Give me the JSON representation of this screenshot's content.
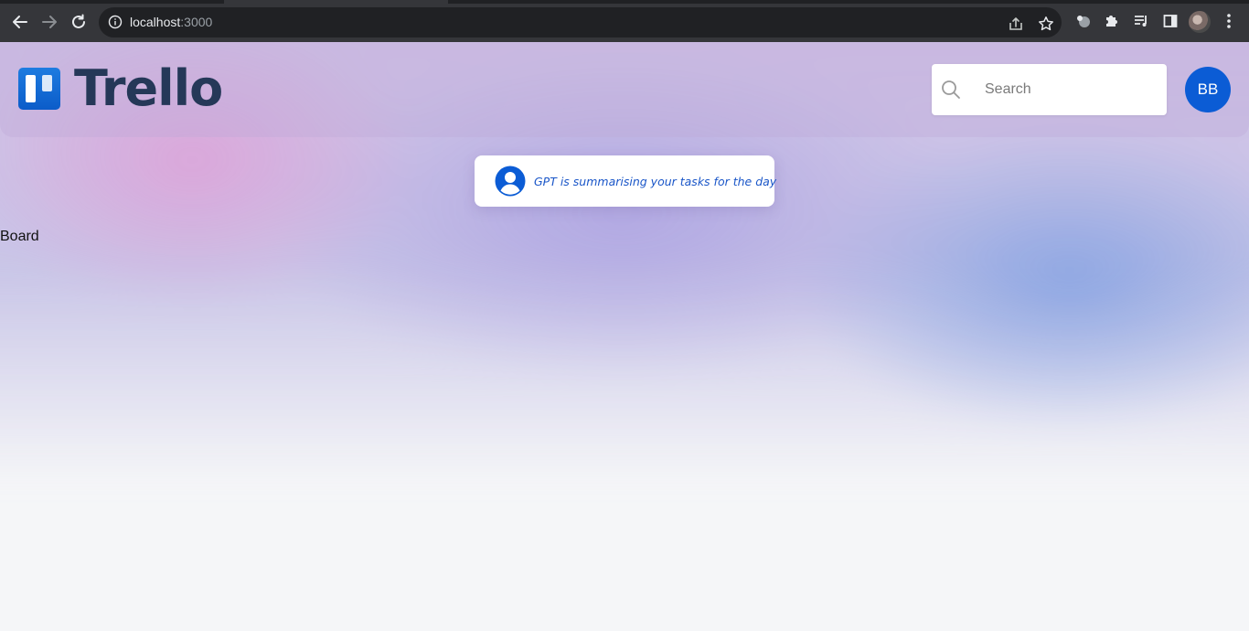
{
  "browser": {
    "url_host": "localhost",
    "url_port": ":3000"
  },
  "header": {
    "logo_text": "Trello",
    "search": {
      "placeholder": "Search"
    },
    "avatar_initials": "BB"
  },
  "summary": {
    "text": "GPT is summarising your tasks for the day"
  },
  "board": {
    "label": "Board"
  },
  "colors": {
    "brand_blue": "#0b5cd5",
    "logo_text": "#253858",
    "summary_text": "#1a56c8"
  }
}
